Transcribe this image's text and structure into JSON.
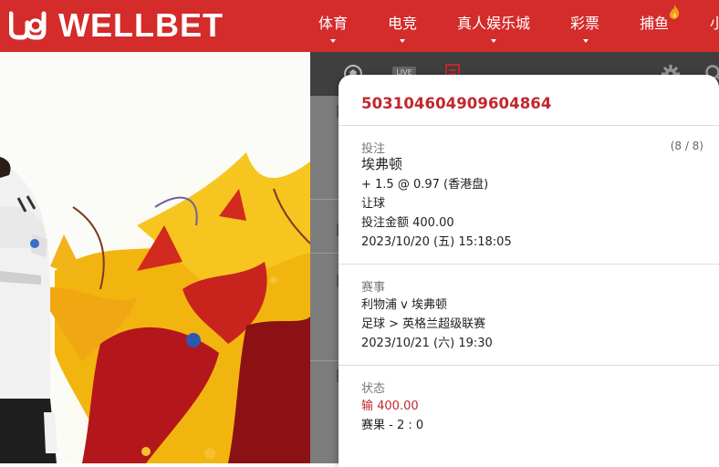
{
  "brand": {
    "name": "WELLBET",
    "colors": {
      "primary": "#d42b2b",
      "accent_text": "#c0282d"
    }
  },
  "nav": {
    "items": [
      {
        "label": "体育",
        "has_dropdown": true
      },
      {
        "label": "电竞",
        "has_dropdown": true
      },
      {
        "label": "真人娱乐城",
        "has_dropdown": true
      },
      {
        "label": "彩票",
        "has_dropdown": true
      },
      {
        "label": "捕鱼",
        "has_dropdown": false,
        "badge_icon": "flame-icon"
      },
      {
        "label": "小",
        "has_dropdown": false
      }
    ]
  },
  "toolbar_icons": [
    "soccer-ball-icon",
    "live-icon",
    "bet-slip-icon",
    "settings-icon",
    "search-icon"
  ],
  "toolbar_live_label": "LIVE",
  "bet": {
    "id": "503104604909604864",
    "bet_section": {
      "title": "投注",
      "count": "(8 / 8)",
      "selection": "埃弗顿",
      "odds_line": "+ 1.5 @ 0.97 (香港盘)",
      "market": "让球",
      "stake": "投注金额 400.00",
      "placed_at": "2023/10/20 (五) 15:18:05"
    },
    "event_section": {
      "title": "赛事",
      "match": "利物浦 v 埃弗顿",
      "league": "足球 > 英格兰超级联赛",
      "kickoff": "2023/10/21 (六) 19:30"
    },
    "status_section": {
      "title": "状态",
      "result": "输 400.00",
      "score": "赛果 - 2 : 0"
    }
  }
}
